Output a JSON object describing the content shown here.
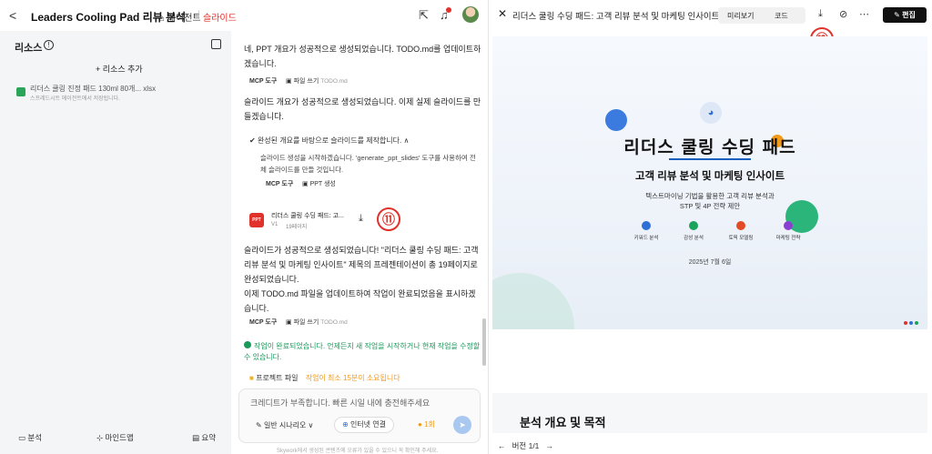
{
  "topbar": {
    "back_glyph": "<",
    "title": "Leaders Cooling Pad 리뷰 분석",
    "agent_label": "에이전트",
    "slides_label": "슬라이드",
    "share_icon": "share-icon",
    "bell_icon": "bell-icon"
  },
  "sidebar": {
    "title": "리소스",
    "add_label": "+ 리소스 추가",
    "file": {
      "name": "리더스 쿨링 진정 패드 130ml 80개... xlsx",
      "sub": "스프레드시트 에이전트에서 저장됩니다."
    },
    "bottom": [
      {
        "label": "분석",
        "icon": "chart-icon"
      },
      {
        "label": "마인드맵",
        "icon": "mindmap-icon"
      },
      {
        "label": "요약",
        "icon": "summary-icon"
      }
    ]
  },
  "chat": {
    "msg1": "네, PPT 개요가 성공적으로 생성되었습니다. TODO.md를 업데이트하겠습니다.",
    "chips1": {
      "mcp": "MCP 도구",
      "file": "파일 쓰기",
      "file_sub": "TODO.md"
    },
    "msg2": "슬라이드 개요가 성공적으로 생성되었습니다. 이제 실제 슬라이드를 만들겠습니다.",
    "task_title": "완성된 개요를 바탕으로 슬라이드를 제작합니다.",
    "task_body": "슬라이드 생성을 시작하겠습니다. 'generate_ppt_slides' 도구를 사용하여 전체 슬라이드를 만들 것입니다.",
    "chips2": {
      "mcp": "MCP 도구",
      "ppt": "PPT 생성"
    },
    "card": {
      "icon_text": "PPT",
      "title": "리더스 쿨링 수딩 패드: 고...",
      "version": "V1",
      "pages": "19페이지"
    },
    "annotation_11": "⑪",
    "msg3": "슬라이드가 성공적으로 생성되었습니다! \"리더스 쿨링 수딩 패드: 고객 리뷰 분석 및 마케팅 인사이트\" 제목의 프레젠테이션이 총 19페이지로 완성되었습니다.",
    "msg4": "이제 TODO.md 파일을 업데이트하여 작업이 완료되었음을 표시하겠습니다.",
    "chips3": {
      "mcp": "MCP 도구",
      "file": "파일 쓰기",
      "file_sub": "TODO.md"
    },
    "done_msg": "작업이 완료되었습니다. 언제든지 새 작업을 시작하거나 현재 작업을 수정할 수 있습니다.",
    "project_file": "프로젝트 파일",
    "project_file_more": "작업이 최소 15분이 소요됩니다",
    "input_placeholder": "크레디트가 부족합니다. 빠른 시일 내에 충전해주세요",
    "scenario": "일반 시나리오 ∨",
    "internet": "인터넷 연결",
    "credit": "1회",
    "footnote": "Skywork에서 생성된 콘텐츠에 오류가 있을 수 있으니 꼭 확인해 주세요."
  },
  "rpanel": {
    "title": "리더스 쿨링 수딩 패드: 고객 리뷰 분석 및 마케팅 인사이트",
    "tab_preview": "미리보기",
    "tab_code": "코드",
    "annotation_12": "⑫",
    "edit_label": "편집",
    "slide1": {
      "title": "리더스 쿨링 수딩 패드",
      "subtitle": "고객 리뷰 분석 및 마케팅 인사이트",
      "desc_line1": "텍스트마이닝 기법을 활용한 고객 리뷰 분석과",
      "desc_line2": "STP 및 4P 전략 제안",
      "features": [
        {
          "label": "키워드 분석",
          "color": "#2f6fd6"
        },
        {
          "label": "감성 분석",
          "color": "#1aa35a"
        },
        {
          "label": "토픽 모델링",
          "color": "#e24b26"
        },
        {
          "label": "마케팅 전략",
          "color": "#8b3fd1"
        }
      ],
      "date": "2025년 7월 6일"
    },
    "slide2_title": "분석 개요 및 목적",
    "version": "버전 1/1"
  }
}
